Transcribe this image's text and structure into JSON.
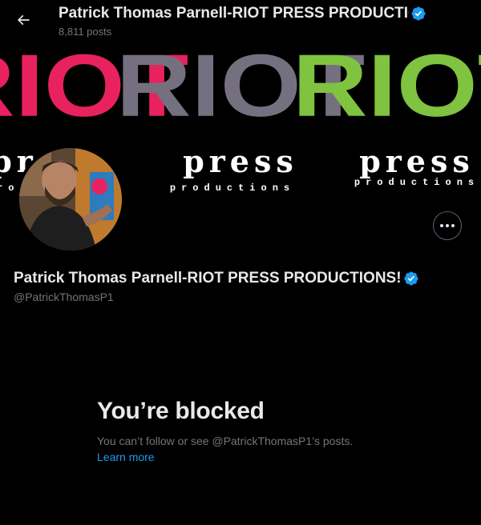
{
  "header": {
    "back_label": "back-arrow-icon",
    "name": "Patrick Thomas Parnell-RIOT PRESS PRODUCTIONS!",
    "posts": "8,811 posts"
  },
  "banner": {
    "riot_words": [
      "RIOT",
      "RIOT",
      "RIOT"
    ],
    "riot_colors": [
      "#e8225e",
      "#75707f",
      "#7fc340"
    ],
    "press_words": [
      "press",
      "press",
      "press"
    ],
    "productions_words": [
      "productions",
      "productions",
      "productions"
    ]
  },
  "profile": {
    "name": "Patrick Thomas Parnell-RIOT PRESS PRODUCTIONS!",
    "handle": "@PatrickThomasP1",
    "verified_color": "#1d9bf0"
  },
  "blocked": {
    "title": "You’re blocked",
    "description": "You can’t follow or see @PatrickThomasP1’s posts.",
    "learn_more": "Learn more"
  },
  "colors": {
    "background": "#000000",
    "text_primary": "#e7e9ea",
    "text_secondary": "#71767b",
    "link": "#1d9bf0"
  }
}
